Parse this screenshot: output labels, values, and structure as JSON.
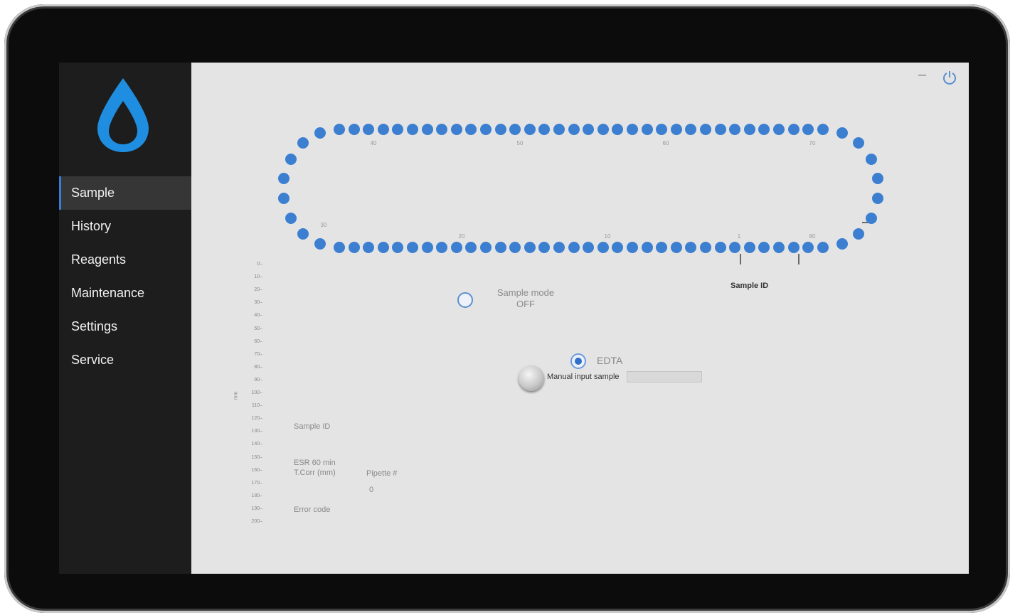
{
  "nav": {
    "items": [
      {
        "label": "Sample",
        "active": true
      },
      {
        "label": "History",
        "active": false
      },
      {
        "label": "Reagents",
        "active": false
      },
      {
        "label": "Maintenance",
        "active": false
      },
      {
        "label": "Settings",
        "active": false
      },
      {
        "label": "Service",
        "active": false
      }
    ]
  },
  "window_controls": {
    "minimize": "–",
    "power_icon": "power-icon"
  },
  "carousel": {
    "top_labels": [
      "40",
      "50",
      "60",
      "70"
    ],
    "bottom_labels": [
      "30",
      "20",
      "10",
      "1",
      "80"
    ],
    "sample_id_label": "Sample ID"
  },
  "sample_mode": {
    "label": "Sample mode",
    "value": "OFF"
  },
  "tube_type": {
    "label": "EDTA",
    "selected": true
  },
  "manual_input": {
    "label": "Manual input sample",
    "value": ""
  },
  "scale": {
    "ticks": [
      "0",
      "10",
      "20",
      "30",
      "40",
      "50",
      "60",
      "70",
      "80",
      "90",
      "100",
      "110",
      "120",
      "130",
      "140",
      "150",
      "160",
      "170",
      "180",
      "190",
      "200"
    ],
    "unit": "mm"
  },
  "info": {
    "sample_id_label": "Sample ID",
    "esr_label": "ESR 60 min",
    "tcorr_label": "T.Corr (mm)",
    "pipette_label": "Pipette #",
    "pipette_value": "0",
    "error_label": "Error code"
  },
  "colors": {
    "accent": "#3c7fd1",
    "sidebar": "#1d1d1d",
    "panel": "#e4e4e4"
  }
}
